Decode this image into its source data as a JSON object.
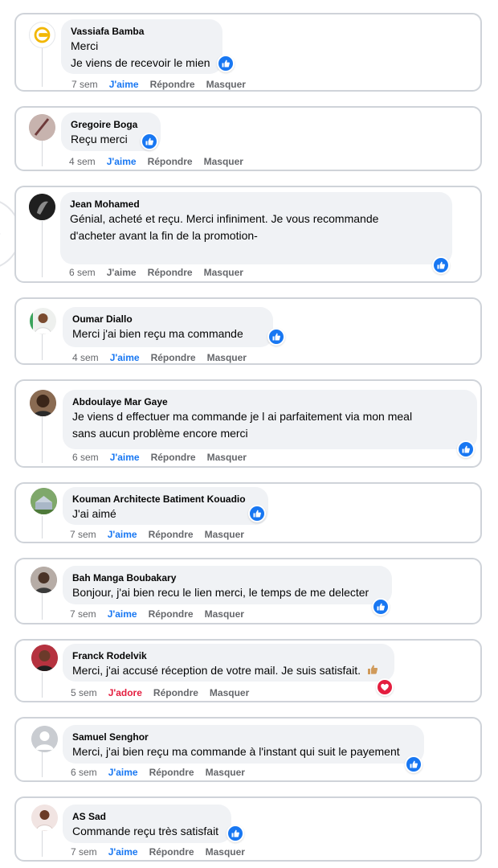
{
  "colors": {
    "like_blue": "#1877f2",
    "love_red": "#e41e3f",
    "bubble": "#f0f2f5",
    "meta_gray": "#65676b"
  },
  "actions": {
    "reply": "Répondre",
    "hide": "Masquer"
  },
  "comments": [
    {
      "author": "Vassiafa Bamba",
      "lines": [
        "Merci",
        "Je viens de recevoir le mien"
      ],
      "time": "7 sem",
      "reaction_label": "J'aime",
      "reaction_icon": "like-icon"
    },
    {
      "author": "Gregoire Boga",
      "lines": [
        "Reçu merci"
      ],
      "time": "4 sem",
      "reaction_label": "J'aime",
      "reaction_icon": "like-icon"
    },
    {
      "author": "Jean Mohamed",
      "lines": [
        "Génial, acheté et reçu. Merci infiniment. Je vous recommande",
        "d'acheter avant la fin de la promotion-"
      ],
      "time": "6 sem",
      "reaction_label": "J'aime",
      "reaction_icon": "like-icon"
    },
    {
      "author": "Oumar Diallo",
      "lines": [
        "Merci j'ai bien reçu ma commande"
      ],
      "time": "4 sem",
      "reaction_label": "J'aime",
      "reaction_icon": "like-icon"
    },
    {
      "author": "Abdoulaye Mar Gaye",
      "lines": [
        "Je viens d effectuer ma commande je l ai parfaitement via mon meal",
        "sans aucun problème encore merci"
      ],
      "time": "6 sem",
      "reaction_label": "J'aime",
      "reaction_icon": "like-icon"
    },
    {
      "author": "Kouman Architecte Batiment Kouadio",
      "lines": [
        "J'ai aimé"
      ],
      "time": "7 sem",
      "reaction_label": "J'aime",
      "reaction_icon": "like-icon"
    },
    {
      "author": "Bah Manga Boubakary",
      "lines": [
        "Bonjour, j'ai bien recu le lien merci, le temps de me delecter"
      ],
      "time": "7 sem",
      "reaction_label": "J'aime",
      "reaction_icon": "like-icon"
    },
    {
      "author": "Franck Rodelvik",
      "lines": [
        "Merci, j'ai accusé réception de votre mail. Je suis satisfait."
      ],
      "time": "5 sem",
      "reaction_label": "J'adore",
      "reaction_icon": "love-icon"
    },
    {
      "author": "Samuel Senghor",
      "lines": [
        "Merci, j'ai bien reçu ma commande à l'instant qui suit le payement"
      ],
      "time": "6 sem",
      "reaction_label": "J'aime",
      "reaction_icon": "like-icon"
    },
    {
      "author": "AS Sad",
      "lines": [
        "Commande reçu très satisfait"
      ],
      "time": "7 sem",
      "reaction_label": "J'aime",
      "reaction_icon": "like-icon"
    }
  ]
}
